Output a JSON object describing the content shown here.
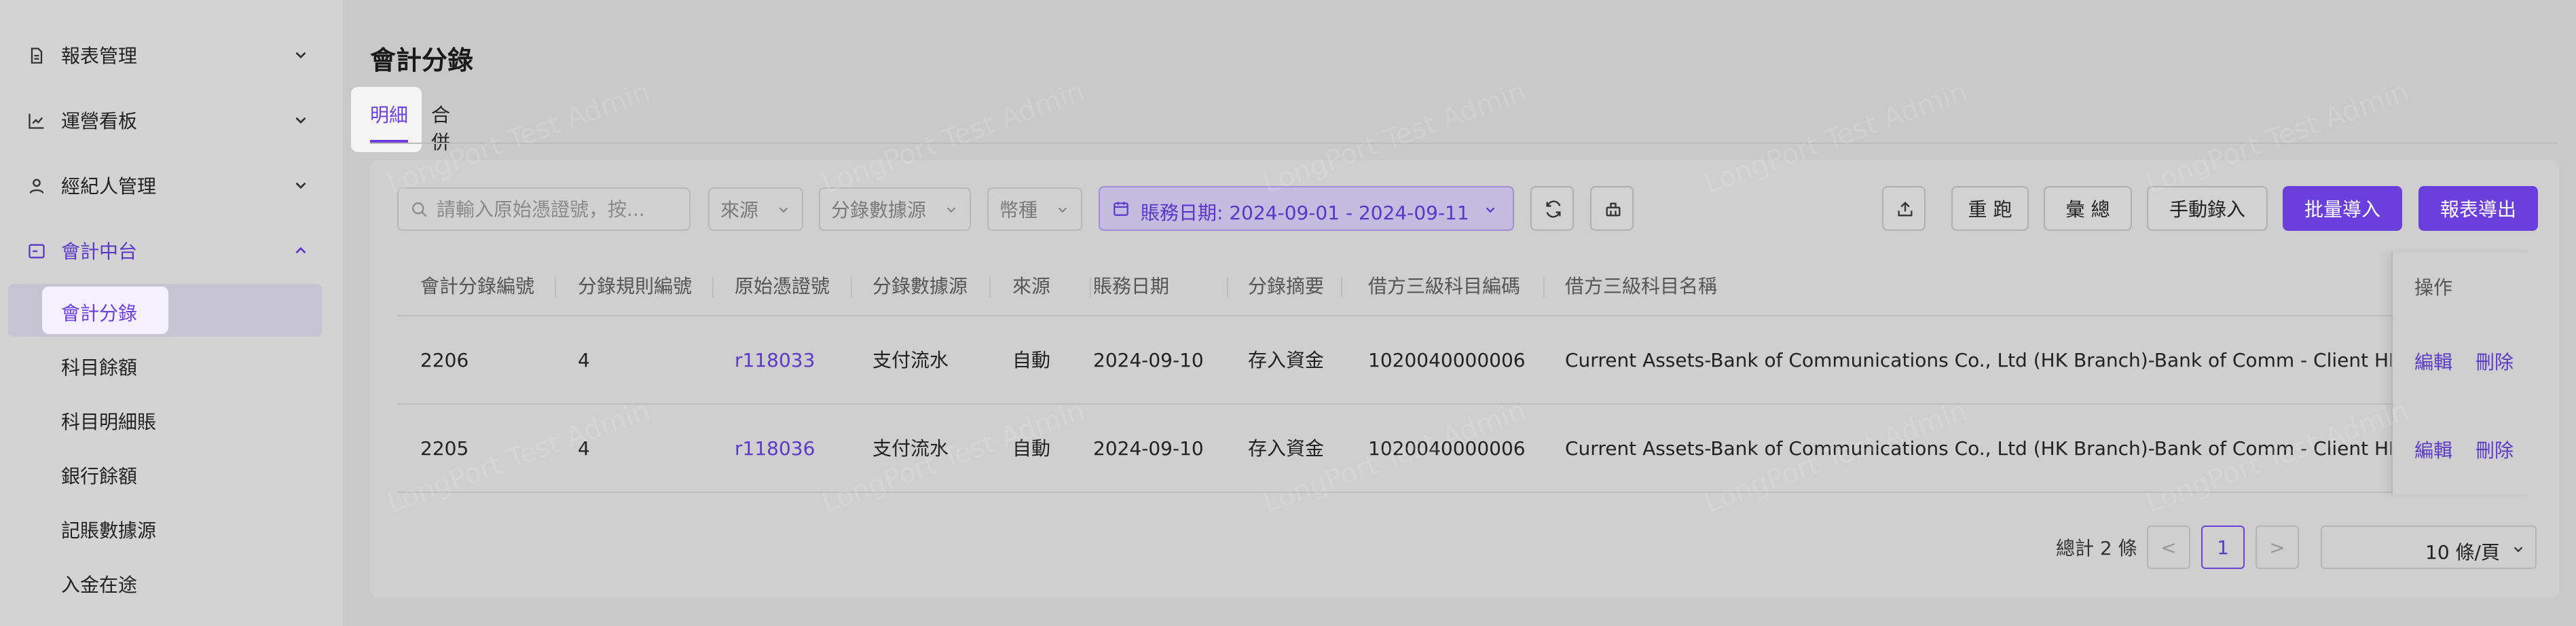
{
  "sidebar": {
    "groups": [
      {
        "label": "報表管理",
        "icon": "report-doc-icon",
        "expanded": false
      },
      {
        "label": "運營看板",
        "icon": "line-chart-icon",
        "expanded": false
      },
      {
        "label": "經紀人管理",
        "icon": "user-icon",
        "expanded": false
      },
      {
        "label": "會計中台",
        "icon": "calculator-icon",
        "expanded": true
      }
    ],
    "sub_items": [
      {
        "label": "會計分錄",
        "active": true
      },
      {
        "label": "科目餘額",
        "active": false
      },
      {
        "label": "科目明細賬",
        "active": false
      },
      {
        "label": "銀行餘額",
        "active": false
      },
      {
        "label": "記賬數據源",
        "active": false
      },
      {
        "label": "入金在途",
        "active": false
      }
    ]
  },
  "page": {
    "title": "會計分錄",
    "tabs": [
      {
        "label": "明細",
        "active": true
      },
      {
        "label": "合併",
        "active": false
      }
    ]
  },
  "filters": {
    "search_placeholder": "請輸入原始憑證號，按...",
    "source_label": "來源",
    "data_source_label": "分錄數據源",
    "currency_label": "幣種",
    "date_label": "賬務日期: 2024-09-01 - 2024-09-11"
  },
  "toolbar": {
    "rerun_label": "重 跑",
    "summary_label": "彙 總",
    "manual_entry_label": "手動錄入",
    "batch_import_label": "批量導入",
    "report_export_label": "報表導出"
  },
  "table": {
    "columns": [
      "會計分錄編號",
      "分錄規則編號",
      "原始憑證號",
      "分錄數據源",
      "來源",
      "賬務日期",
      "分錄摘要",
      "借方三級科目編碼",
      "借方三級科目名稱",
      "操作"
    ],
    "rows": [
      {
        "id": "2206",
        "rule": "4",
        "voucher": "r118033",
        "data_source": "支付流水",
        "source": "自動",
        "date": "2024-09-10",
        "summary": "存入資金",
        "debit_code": "1020040000006",
        "debit_name": "Current Assets-Bank of Communications Co., Ltd (HK Branch)-Bank of Comm - Client HKD C/A",
        "edit": "編輯",
        "delete": "刪除"
      },
      {
        "id": "2205",
        "rule": "4",
        "voucher": "r118036",
        "data_source": "支付流水",
        "source": "自動",
        "date": "2024-09-10",
        "summary": "存入資金",
        "debit_code": "1020040000006",
        "debit_name": "Current Assets-Bank of Communications Co., Ltd (HK Branch)-Bank of Comm - Client HKD C/A",
        "edit": "編輯",
        "delete": "刪除"
      }
    ]
  },
  "pagination": {
    "total_text": "總計 2 條",
    "prev": "<",
    "current_page": "1",
    "next": ">",
    "page_size": "10 條/頁"
  },
  "watermark": "LongPort Test Admin",
  "colors": {
    "accent": "#6a3fdb",
    "link": "#5b3ac7",
    "overlay_bg": "#c9c9c9"
  }
}
